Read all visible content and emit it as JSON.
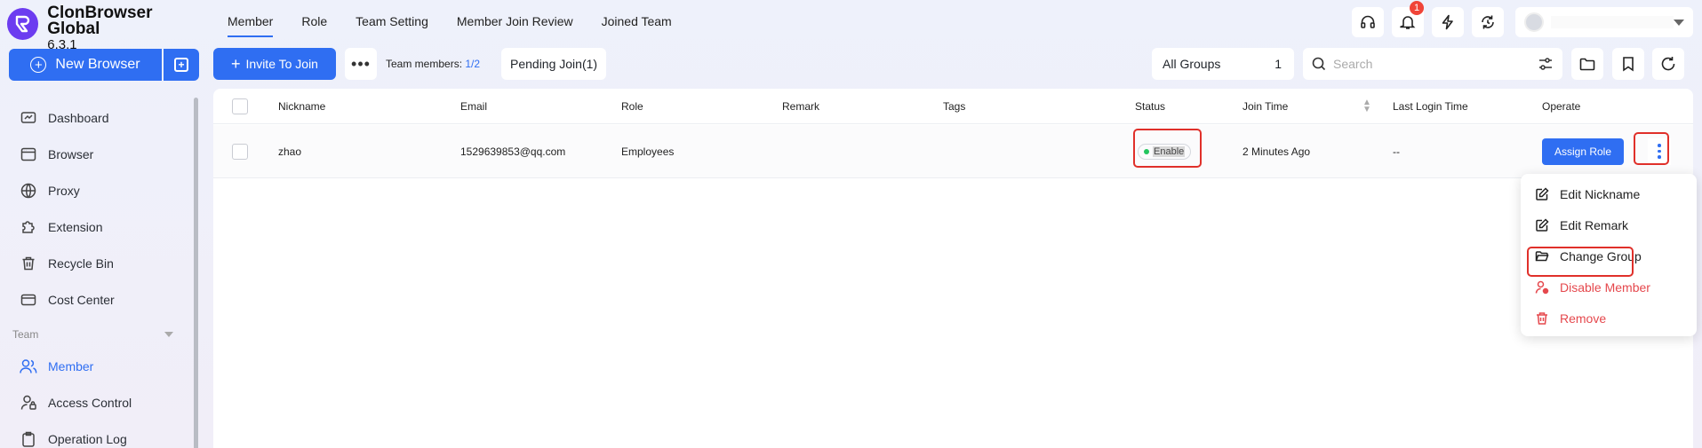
{
  "app": {
    "name": "ClonBrowser Global",
    "version": "6.3.1"
  },
  "sidebar": {
    "new_browser_label": "New Browser",
    "items": [
      {
        "label": "Dashboard",
        "icon": "dashboard-icon"
      },
      {
        "label": "Browser",
        "icon": "browser-icon"
      },
      {
        "label": "Proxy",
        "icon": "globe-icon"
      },
      {
        "label": "Extension",
        "icon": "puzzle-icon"
      },
      {
        "label": "Recycle Bin",
        "icon": "trash-icon"
      },
      {
        "label": "Cost Center",
        "icon": "wallet-icon"
      }
    ],
    "section_team": "Team",
    "team_items": [
      {
        "label": "Member",
        "icon": "users-icon",
        "active": true
      },
      {
        "label": "Access Control",
        "icon": "user-lock-icon"
      },
      {
        "label": "Operation Log",
        "icon": "clipboard-icon"
      }
    ]
  },
  "tabs": [
    {
      "label": "Member",
      "active": true
    },
    {
      "label": "Role"
    },
    {
      "label": "Team Setting"
    },
    {
      "label": "Member Join Review"
    },
    {
      "label": "Joined Team"
    }
  ],
  "topbar": {
    "notification_count": "1"
  },
  "toolbar": {
    "invite_label": "Invite To Join",
    "members_label": "Team members:",
    "members_count": "1/2",
    "pending_label": "Pending Join(1)",
    "group_label": "All Groups",
    "group_count": "1",
    "search_placeholder": "Search"
  },
  "table": {
    "headers": [
      "Nickname",
      "Email",
      "Role",
      "Remark",
      "Tags",
      "Status",
      "Join Time",
      "Last Login Time",
      "Operate"
    ],
    "rows": [
      {
        "nickname": "zhao",
        "email": "1529639853@qq.com",
        "role": "Employees",
        "remark": "",
        "tags": "",
        "status": "Enable",
        "join_time": "2 Minutes Ago",
        "last_login": "--",
        "assign_label": "Assign Role"
      }
    ]
  },
  "menu": {
    "items": [
      {
        "label": "Edit Nickname",
        "icon": "edit-icon"
      },
      {
        "label": "Edit Remark",
        "icon": "edit-icon"
      },
      {
        "label": "Change Group",
        "icon": "folder-icon"
      },
      {
        "label": "Disable Member",
        "icon": "user-disable-icon",
        "danger": true
      },
      {
        "label": "Remove",
        "icon": "trash-icon",
        "danger": true
      }
    ]
  },
  "colors": {
    "accent": "#2f6ef2",
    "danger": "#e5484d",
    "highlight": "#e0302a",
    "brand": "#6c3cf0"
  }
}
